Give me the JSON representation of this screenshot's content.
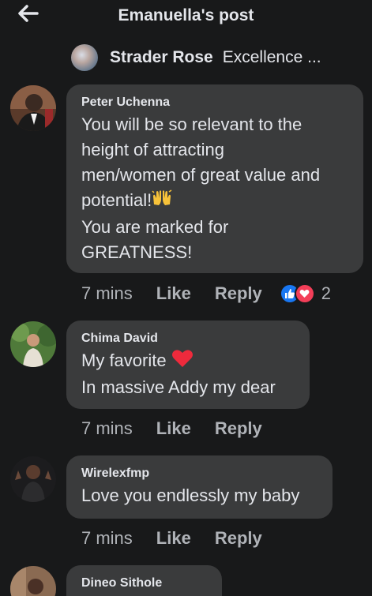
{
  "header": {
    "title": "Emanuella's post"
  },
  "post": {
    "author": "Strader Rose",
    "preview": "Excellence ..."
  },
  "comments": [
    {
      "name": "Peter Uchenna",
      "lines": [
        "You will be so relevant to the",
        "height of attracting",
        "men/women of great value and",
        "potential!",
        "You are marked for",
        "GREATNESS!"
      ],
      "emoji": "raising-hands",
      "time": "7 mins",
      "like": "Like",
      "reply": "Reply",
      "reaction_count": "2",
      "reactions": [
        "like",
        "love"
      ]
    },
    {
      "name": "Chima David",
      "lines": [
        "My favorite",
        "In massive Addy my dear"
      ],
      "emoji": "red-heart",
      "time": "7 mins",
      "like": "Like",
      "reply": "Reply"
    },
    {
      "name": "Wirelexfmp",
      "lines": [
        "Love you endlessly my baby"
      ],
      "time": "7 mins",
      "like": "Like",
      "reply": "Reply"
    },
    {
      "name": "Dineo Sithole"
    }
  ],
  "colors": {
    "background": "#18191a",
    "bubble": "#3a3b3c",
    "text_primary": "#e4e6eb",
    "text_secondary": "#b0b3b8",
    "like_blue": "#1877f2",
    "love_red": "#f33e58"
  }
}
